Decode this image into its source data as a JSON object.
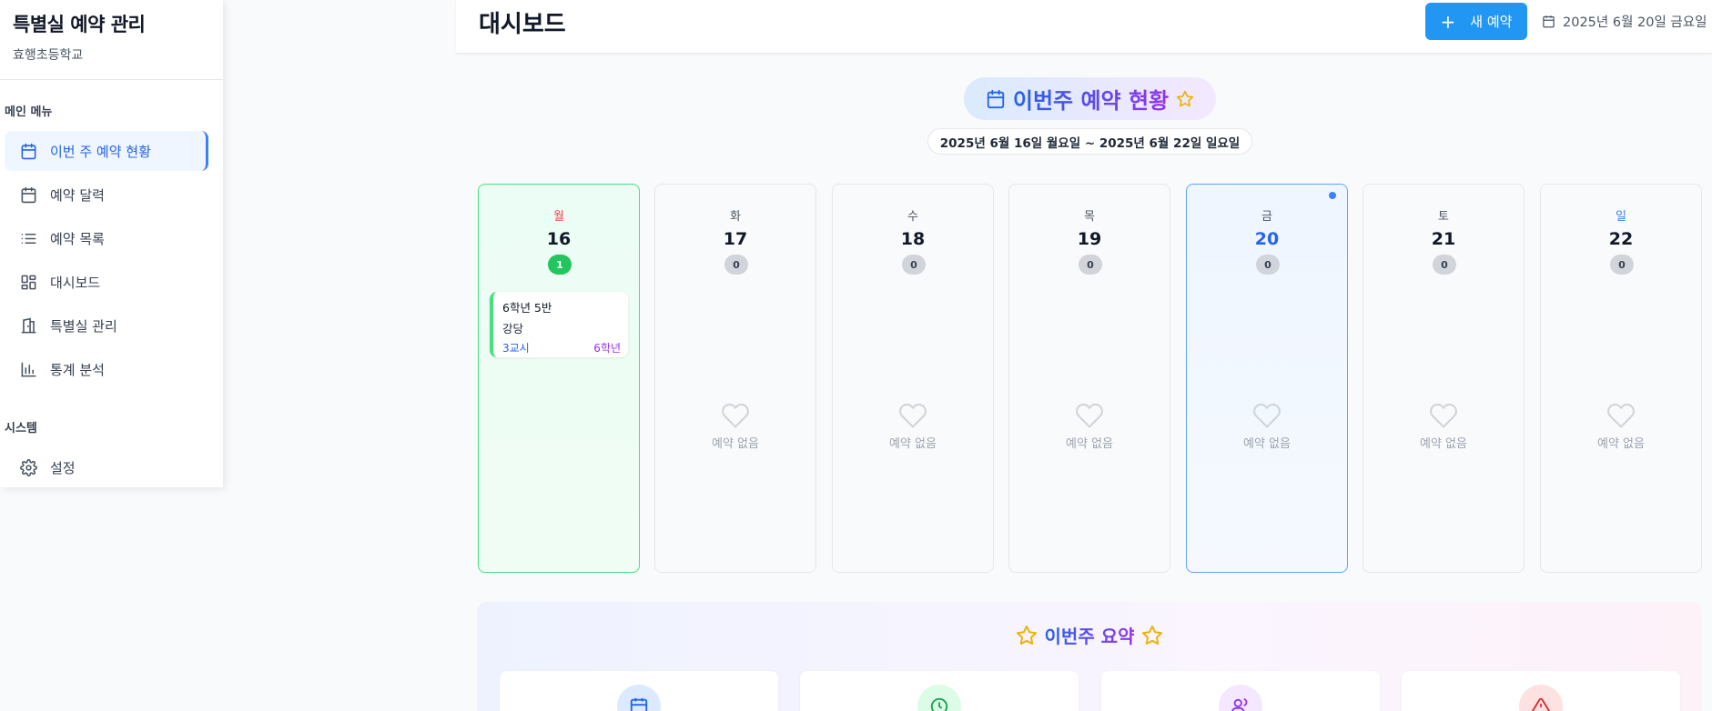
{
  "sidebar": {
    "title": "특별실 예약 관리",
    "subtitle": "효행초등학교",
    "main_menu_label": "메인 메뉴",
    "system_label": "시스템",
    "items": [
      {
        "label": "이번 주 예약 현황",
        "icon": "calendar-icon",
        "active": true
      },
      {
        "label": "예약 달력",
        "icon": "calendar-icon"
      },
      {
        "label": "예약 목록",
        "icon": "list-icon"
      },
      {
        "label": "대시보드",
        "icon": "dashboard-icon"
      },
      {
        "label": "특별실 관리",
        "icon": "building-icon"
      },
      {
        "label": "통계 분석",
        "icon": "bar-chart-icon"
      }
    ],
    "settings_label": "설정"
  },
  "header": {
    "title": "대시보드",
    "new_button_label": "새 예약",
    "today": "2025년 6월 20일 금요일"
  },
  "week": {
    "title": "이번주 예약 현황",
    "range": "2025년 6월 16일 월요일 ~ 2025년 6월 22일 일요일",
    "empty_label": "예약 없음",
    "days": [
      {
        "dow": "월",
        "date": "16",
        "count": "1"
      },
      {
        "dow": "화",
        "date": "17",
        "count": "0"
      },
      {
        "dow": "수",
        "date": "18",
        "count": "0"
      },
      {
        "dow": "목",
        "date": "19",
        "count": "0"
      },
      {
        "dow": "금",
        "date": "20",
        "count": "0"
      },
      {
        "dow": "토",
        "date": "21",
        "count": "0"
      },
      {
        "dow": "일",
        "date": "22",
        "count": "0"
      }
    ],
    "booking": {
      "class": "6학년 5반",
      "room": "강당",
      "period": "3교시",
      "grade": "6학년"
    }
  },
  "summary": {
    "title": "이번주 요약"
  },
  "colors": {
    "accent": "#2196f3",
    "monday": "#ef4444",
    "sunday": "#3b82f6",
    "success": "#22c55e"
  }
}
